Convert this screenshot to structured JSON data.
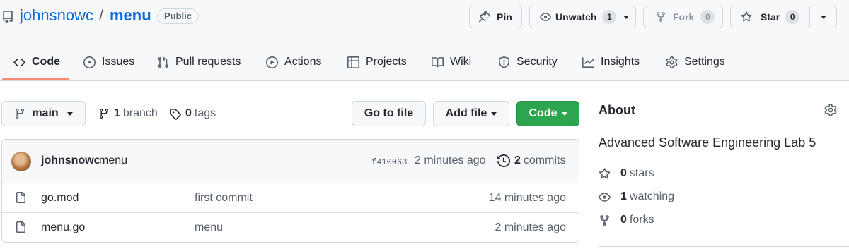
{
  "repo": {
    "owner": "johnsnowc",
    "separator": "/",
    "name": "menu",
    "visibility": "Public"
  },
  "actions": {
    "pin_label": "Pin",
    "unwatch_label": "Unwatch",
    "unwatch_count": "1",
    "fork_label": "Fork",
    "fork_count": "0",
    "star_label": "Star",
    "star_count": "0"
  },
  "tabs": [
    {
      "label": "Code",
      "icon": "code-icon",
      "selected": true
    },
    {
      "label": "Issues",
      "icon": "issue-icon"
    },
    {
      "label": "Pull requests",
      "icon": "pull-request-icon"
    },
    {
      "label": "Actions",
      "icon": "play-icon"
    },
    {
      "label": "Projects",
      "icon": "table-icon"
    },
    {
      "label": "Wiki",
      "icon": "book-icon"
    },
    {
      "label": "Security",
      "icon": "shield-icon"
    },
    {
      "label": "Insights",
      "icon": "graph-icon"
    },
    {
      "label": "Settings",
      "icon": "gear-icon"
    }
  ],
  "toolbar": {
    "branch": "main",
    "branch_count": "1",
    "branch_word": "branch",
    "tag_count": "0",
    "tag_word": "tags",
    "go_to_file": "Go to file",
    "add_file": "Add file",
    "code": "Code"
  },
  "latest_commit": {
    "author": "johnsnowc",
    "message": "menu",
    "sha": "f410063",
    "time": "2 minutes ago",
    "commit_count": "2",
    "commit_word": "commits"
  },
  "files": [
    {
      "name": "go.mod",
      "message": "first commit",
      "age": "14 minutes ago",
      "icon": "file-icon"
    },
    {
      "name": "menu.go",
      "message": "menu",
      "age": "2 minutes ago",
      "icon": "file-icon"
    }
  ],
  "about": {
    "title": "About",
    "description": "Advanced Software Engineering Lab 5",
    "stars_count": "0",
    "stars_word": "stars",
    "watching_count": "1",
    "watching_word": "watching",
    "forks_count": "0",
    "forks_word": "forks"
  },
  "colors": {
    "link": "#0969da",
    "primary_button": "#2da44e",
    "selected_tab_underline": "#fd8c73"
  }
}
